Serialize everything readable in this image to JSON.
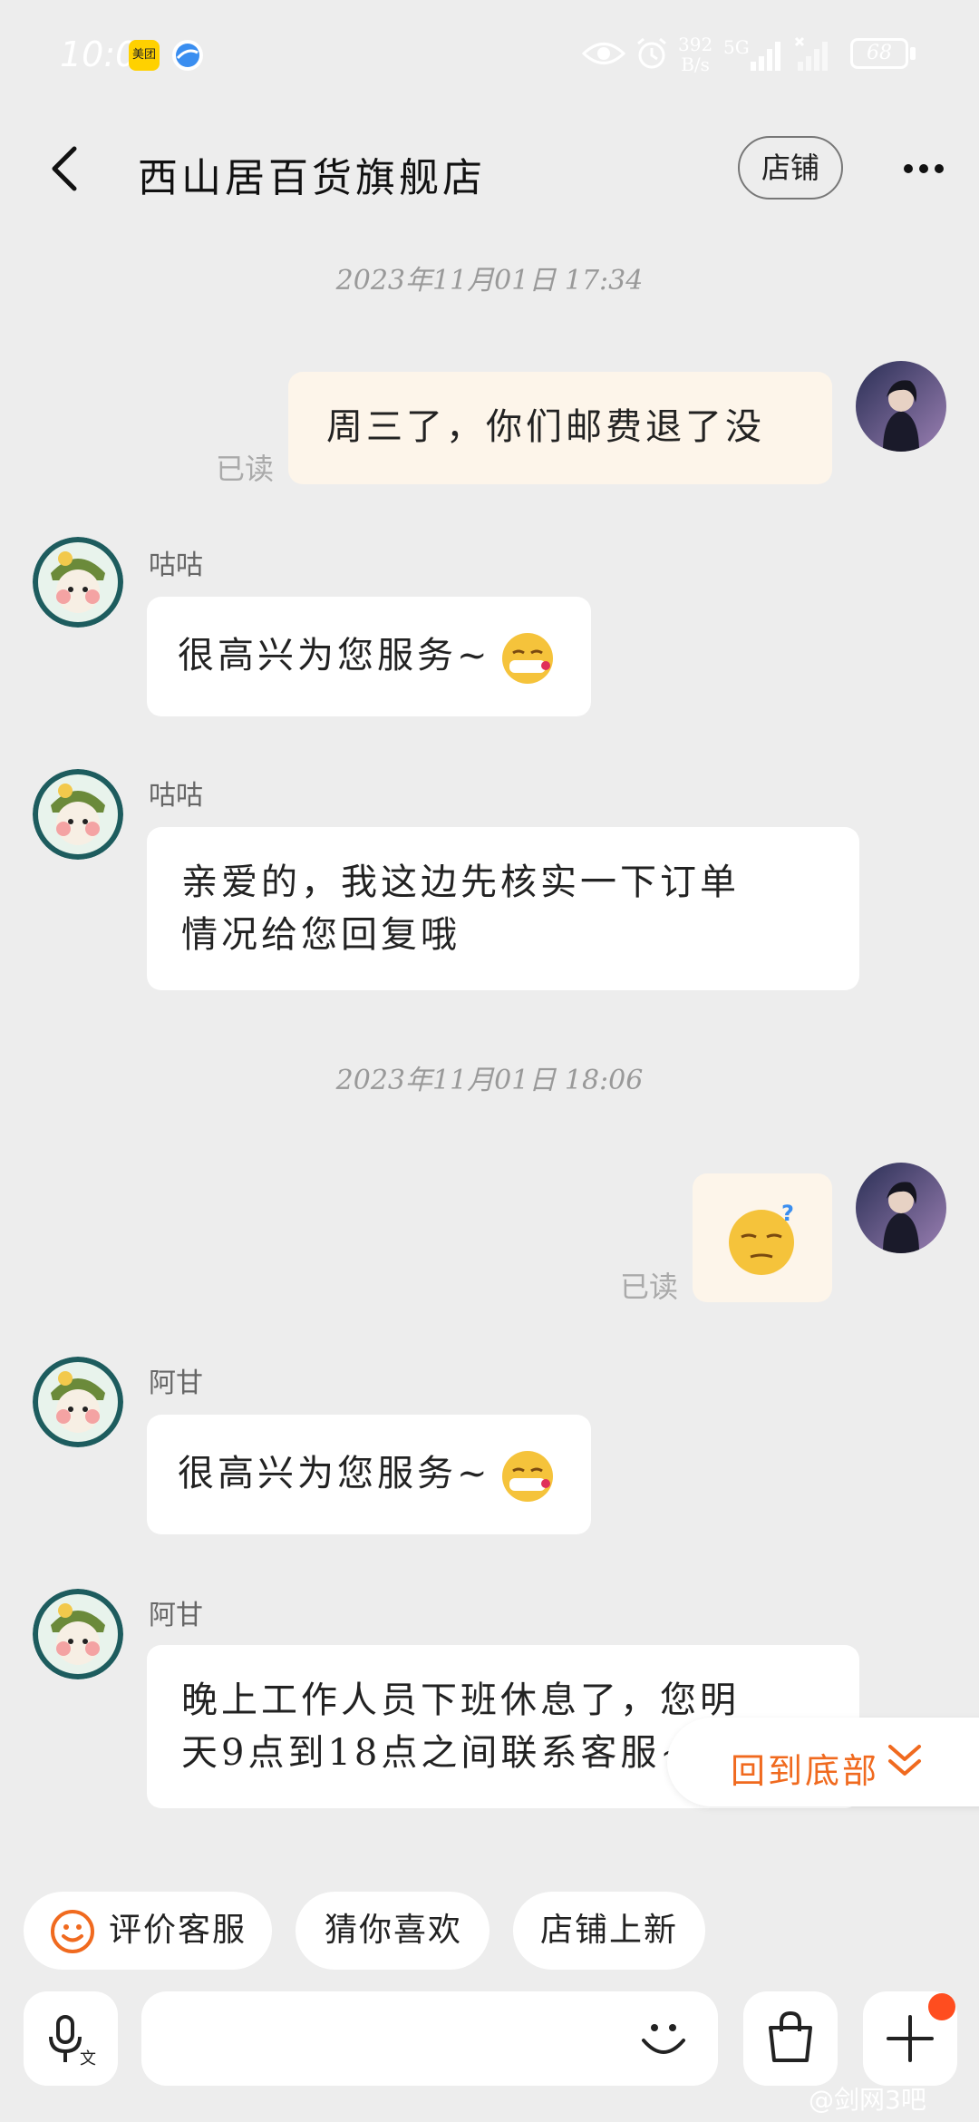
{
  "status": {
    "time": "10:06",
    "speed_value": "392",
    "speed_unit": "B/s",
    "network": "5G",
    "battery": "68",
    "app_badge_text": "美团"
  },
  "header": {
    "title": "西山居百货旗舰店",
    "store_button": "店铺"
  },
  "chat": {
    "timestamps": [
      "2023年11月01日 17:34",
      "2023年11月01日 18:06"
    ],
    "messages": [
      {
        "sender": "",
        "text": "周三了，你们邮费退了没",
        "status": "已读"
      },
      {
        "sender": "咕咕",
        "text": "很高兴为您服务~"
      },
      {
        "sender": "咕咕",
        "line1": "亲爱的，我这边先核实一下订单",
        "line2": "情况给您回复哦"
      },
      {
        "sender": "",
        "text": "",
        "status": "已读"
      },
      {
        "sender": "阿甘",
        "text": "很高兴为您服务~"
      },
      {
        "sender": "阿甘",
        "line1": "晚上工作人员下班休息了，您明",
        "line2": "天9点到18点之间联系客服~"
      }
    ]
  },
  "back_to_bottom": "回到底部",
  "chips": [
    "评价客服",
    "猜你喜欢",
    "店铺上新"
  ],
  "input": {
    "placeholder": ""
  },
  "watermark": "@剑网3吧",
  "colors": {
    "accent": "#f06a1f",
    "mine_bubble": "#fdf5ea",
    "background": "#ededed",
    "badge": "#ff4d1f"
  }
}
